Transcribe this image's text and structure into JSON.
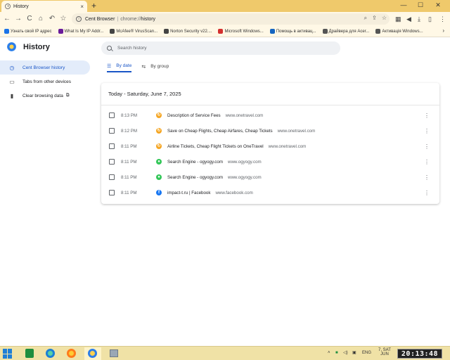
{
  "window": {
    "tab_title": "History",
    "tab_close": "×",
    "new_tab": "+",
    "controls": {
      "minimize": "—",
      "maximize": "☐",
      "close": "✕"
    }
  },
  "toolbar": {
    "back": "←",
    "forward": "→",
    "reload": "C",
    "home": "⌂",
    "undo": "↶",
    "bookmark": "☆",
    "site_name": "Cent Browser",
    "url_prefix": "chrome://",
    "url_path": "history"
  },
  "bookmarks": [
    {
      "label": "Узнать свой IP адрес",
      "color": "#1a73e8"
    },
    {
      "label": "What Is My IP Addr...",
      "color": "#6a1b9a"
    },
    {
      "label": "McAfee® VirusScan...",
      "color": "#444444"
    },
    {
      "label": "Norton Security v22....",
      "color": "#444444"
    },
    {
      "label": "Microsoft Windows...",
      "color": "#d32f2f"
    },
    {
      "label": "Помощь в активац...",
      "color": "#1565c0"
    },
    {
      "label": "Драйвера для Acer...",
      "color": "#555555"
    },
    {
      "label": "Активація Windows...",
      "color": "#555555"
    }
  ],
  "bookmarks_more": "›",
  "page": {
    "title": "History",
    "search_placeholder": "Search history"
  },
  "sidebar": {
    "items": [
      {
        "label": "Cent Browser history",
        "icon": "clock-icon",
        "active": true
      },
      {
        "label": "Tabs from other devices",
        "icon": "devices-icon",
        "active": false
      },
      {
        "label": "Clear browsing data",
        "icon": "trash-icon",
        "active": false
      }
    ]
  },
  "tabs": [
    {
      "label": "By date",
      "active": true
    },
    {
      "label": "By group",
      "active": false
    }
  ],
  "history": {
    "date_header": "Today - Saturday, June 7, 2025",
    "entries": [
      {
        "time": "8:13 PM",
        "title": "Description of Service Fees",
        "domain": "www.onetravel.com",
        "icon": "onetravel-icon"
      },
      {
        "time": "8:12 PM",
        "title": "Save on Cheap Flights, Cheap Airfares, Cheap Tickets",
        "domain": "www.onetravel.com",
        "icon": "onetravel-icon"
      },
      {
        "time": "8:11 PM",
        "title": "Airline Tickets, Cheap Flight Tickets on OneTravel",
        "domain": "www.onetravel.com",
        "icon": "onetravel-icon"
      },
      {
        "time": "8:11 PM",
        "title": "Search Engine - ogyogy.com",
        "domain": "www.ogyogy.com",
        "icon": "ogyogy-icon"
      },
      {
        "time": "8:11 PM",
        "title": "Search Engine - ogyogy.com",
        "domain": "www.ogyogy.com",
        "icon": "ogyogy-icon"
      },
      {
        "time": "8:11 PM",
        "title": "impact-t.ru | Facebook",
        "domain": "www.facebook.com",
        "icon": "facebook-icon"
      }
    ]
  },
  "taskbar": {
    "language": "ENG",
    "date_line1": "7, SAT",
    "date_line2": "JUN",
    "clock": "20:13:48"
  },
  "colors": {
    "tabstrip": "#efc96b",
    "accent": "#1a56c7",
    "onetravel": "#f5a623",
    "ogyogy": "#34c759",
    "facebook": "#1877f2"
  }
}
